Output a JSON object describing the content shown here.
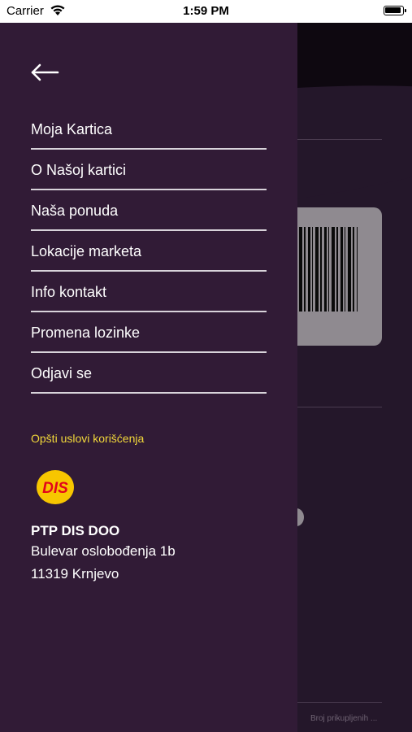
{
  "status_bar": {
    "carrier": "Carrier",
    "time": "1:59 PM"
  },
  "menu": {
    "back_icon": "arrow-left-icon",
    "items": [
      {
        "label": "Moja Kartica"
      },
      {
        "label": "O Našoj kartici"
      },
      {
        "label": "Naša ponuda"
      },
      {
        "label": "Lokacije marketa"
      },
      {
        "label": "Info kontakt"
      },
      {
        "label": "Promena lozinke"
      },
      {
        "label": "Odjavi se"
      }
    ],
    "terms_label": "Opšti uslovi korišćenja"
  },
  "logo": {
    "text": "DIS",
    "colors": {
      "circle": "#f7c600",
      "text": "#e3051b"
    }
  },
  "company": {
    "name": "PTP DIS DOO",
    "address": "Bulevar oslobođenja 1b",
    "city": "11319 Krnjevo"
  },
  "background_page": {
    "footer_text": "Broj prikupljenih ..."
  },
  "colors": {
    "drawer": "#311b36",
    "accent_link": "#f2d83a",
    "divider": "#d8d3da"
  }
}
